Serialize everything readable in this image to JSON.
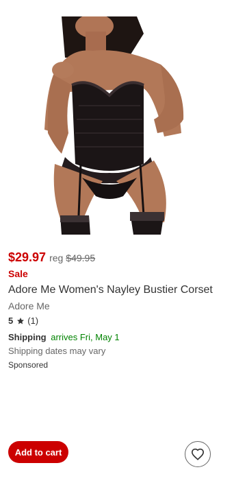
{
  "product": {
    "image_alt": "Adore Me Women's Nayley Bustier Corset",
    "price_current": "$29.97",
    "price_reg_label": "reg",
    "price_reg": "$49.95",
    "sale_label": "Sale",
    "title": "Adore Me Women's Nayley Bustier Corset",
    "brand": "Adore Me",
    "rating": {
      "score": "5",
      "count": "(1)",
      "icon": "star-icon"
    },
    "shipping": {
      "label": "Shipping",
      "arrival": "arrives Fri, May 1",
      "note": "Shipping dates may vary"
    },
    "sponsored_label": "Sponsored"
  },
  "actions": {
    "add_to_cart_label": "Add to cart",
    "favorite_icon": "heart-icon"
  },
  "colors": {
    "price_red": "#cc0000",
    "shipping_green": "#008300",
    "button_red": "#cc0000"
  }
}
